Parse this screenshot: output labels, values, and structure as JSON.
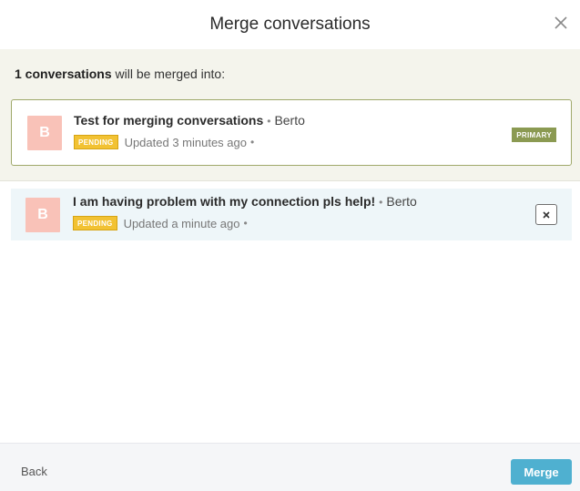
{
  "modal": {
    "title": "Merge conversations"
  },
  "summary": {
    "count_text": "1 conversations",
    "rest_text": " will be merged into:"
  },
  "primary_conversation": {
    "avatar_letter": "B",
    "title": "Test for merging conversations",
    "author": "Berto",
    "status": "PENDING",
    "updated": "Updated 3 minutes ago",
    "badge": "PRIMARY"
  },
  "merge_conversations": [
    {
      "avatar_letter": "B",
      "title": "I am having problem with my connection pls help!",
      "author": "Berto",
      "status": "PENDING",
      "updated": "Updated a minute ago"
    }
  ],
  "footer": {
    "back_label": "Back",
    "merge_label": "Merge"
  },
  "colors": {
    "summary_bg": "#f4f4ec",
    "primary_border": "#9fa86a",
    "primary_badge": "#8b9a52",
    "pending_badge": "#f2c233",
    "avatar": "#f9c2b8",
    "selected_row_bg": "#eef6f9",
    "merge_button": "#4fb0d0"
  },
  "icons": {
    "close": "close-icon",
    "remove": "remove-icon"
  }
}
